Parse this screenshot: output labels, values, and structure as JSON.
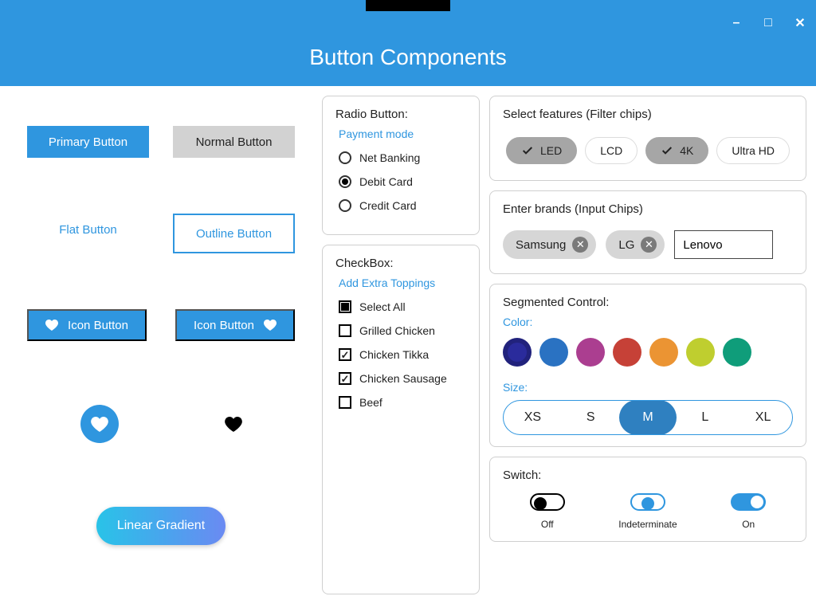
{
  "title": "Button Components",
  "window_controls": {
    "min": "–",
    "max": "□",
    "close": "✕"
  },
  "buttons": {
    "primary": "Primary Button",
    "normal": "Normal Button",
    "flat": "Flat Button",
    "outline": "Outline Button",
    "icon_left": "Icon Button",
    "icon_right": "Icon Button",
    "gradient": "Linear Gradient"
  },
  "radio": {
    "title": "Radio Button:",
    "group_label": "Payment mode",
    "items": [
      {
        "label": "Net Banking",
        "checked": false
      },
      {
        "label": "Debit Card",
        "checked": true
      },
      {
        "label": "Credit Card",
        "checked": false
      }
    ]
  },
  "checkbox": {
    "title": "CheckBox:",
    "group_label": "Add Extra Toppings",
    "items": [
      {
        "label": "Select All",
        "state": "indeterminate"
      },
      {
        "label": "Grilled Chicken",
        "state": "unchecked"
      },
      {
        "label": "Chicken Tikka",
        "state": "checked"
      },
      {
        "label": "Chicken Sausage",
        "state": "checked"
      },
      {
        "label": "Beef",
        "state": "unchecked"
      }
    ]
  },
  "filter_chips": {
    "title": "Select features (Filter chips)",
    "items": [
      {
        "label": "LED",
        "selected": true
      },
      {
        "label": "LCD",
        "selected": false
      },
      {
        "label": "4K",
        "selected": true
      },
      {
        "label": "Ultra HD",
        "selected": false
      }
    ]
  },
  "input_chips": {
    "title": "Enter brands (Input Chips)",
    "items": [
      "Samsung",
      "LG"
    ],
    "input_value": "Lenovo"
  },
  "segmented": {
    "title": "Segmented Control:",
    "color_label": "Color:",
    "colors": [
      "#2a2b9c",
      "#2a72c2",
      "#ab3e90",
      "#c64137",
      "#eb9433",
      "#bfce2f",
      "#0f9d7a"
    ],
    "selected_color_index": 0,
    "size_label": "Size:",
    "sizes": [
      "XS",
      "S",
      "M",
      "L",
      "XL"
    ],
    "selected_size_index": 2
  },
  "switch": {
    "title": "Switch:",
    "labels": {
      "off": "Off",
      "indeterminate": "Indeterminate",
      "on": "On"
    }
  }
}
